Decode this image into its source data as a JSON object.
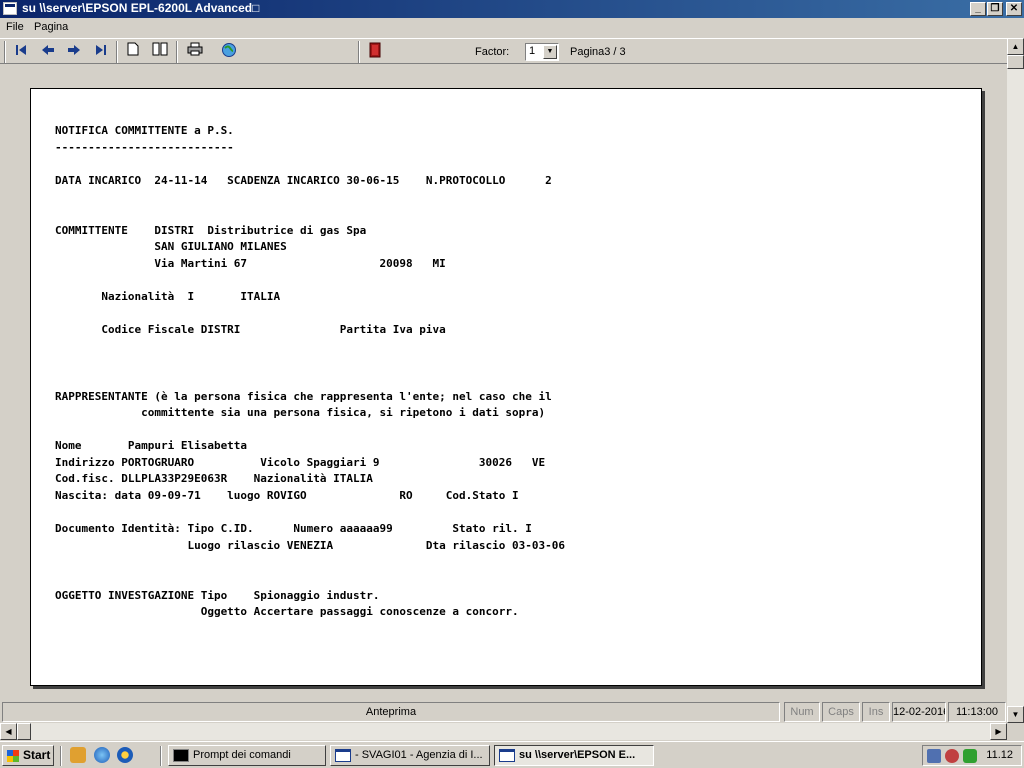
{
  "window": {
    "title": "su \\\\server\\EPSON EPL-6200L Advanced□",
    "minimize_glyph": "_",
    "maximize_glyph": "❐",
    "close_glyph": "✕"
  },
  "menu": [
    "File",
    "Pagina"
  ],
  "toolbar": {
    "factor_label": "Factor:",
    "factor_value": "1",
    "page_indicator": "Pagina3 / 3"
  },
  "document": {
    "lines": [
      "NOTIFICA COMMITTENTE a P.S.",
      "---------------------------",
      "",
      "DATA INCARICO  24-11-14   SCADENZA INCARICO 30-06-15    N.PROTOCOLLO      2",
      "",
      "",
      "COMMITTENTE    DISTRI  Distributrice di gas Spa",
      "               SAN GIULIANO MILANES",
      "               Via Martini 67                    20098   MI",
      "",
      "       Nazionalità  I       ITALIA",
      "",
      "       Codice Fiscale DISTRI               Partita Iva piva",
      "",
      "",
      "",
      "RAPPRESENTANTE (è la persona fisica che rappresenta l'ente; nel caso che il",
      "             committente sia una persona fisica, si ripetono i dati sopra)",
      "",
      "Nome       Pampuri Elisabetta",
      "Indirizzo PORTOGRUARO          Vicolo Spaggiari 9               30026   VE",
      "Cod.fisc. DLLPLA33P29E063R    Nazionalità ITALIA",
      "Nascita: data 09-09-71    luogo ROVIGO              RO     Cod.Stato I",
      "",
      "Documento Identità: Tipo C.ID.      Numero aaaaaa99         Stato ril. I",
      "                    Luogo rilascio VENEZIA              Dta rilascio 03-03-06",
      "",
      "",
      "OGGETTO INVESTGAZIONE Tipo    Spionaggio industr.",
      "                      Oggetto Accertare passaggi conoscenze a concorr."
    ]
  },
  "statusbar": {
    "mode": "Anteprima",
    "num": "Num",
    "caps": "Caps",
    "ins": "Ins",
    "date": "12-02-2016",
    "time": "11:13:00"
  },
  "taskbar": {
    "start_label": "Start",
    "tasks": [
      "Prompt dei comandi",
      " - SVAGI01 - Agenzia di I...",
      "su \\\\server\\EPSON E..."
    ],
    "clock": "11.12"
  },
  "colors": {
    "titlebar_start": "#0a246a",
    "titlebar_end": "#3a6ea5",
    "chrome": "#d4d0c8",
    "paper": "#ffffff"
  }
}
